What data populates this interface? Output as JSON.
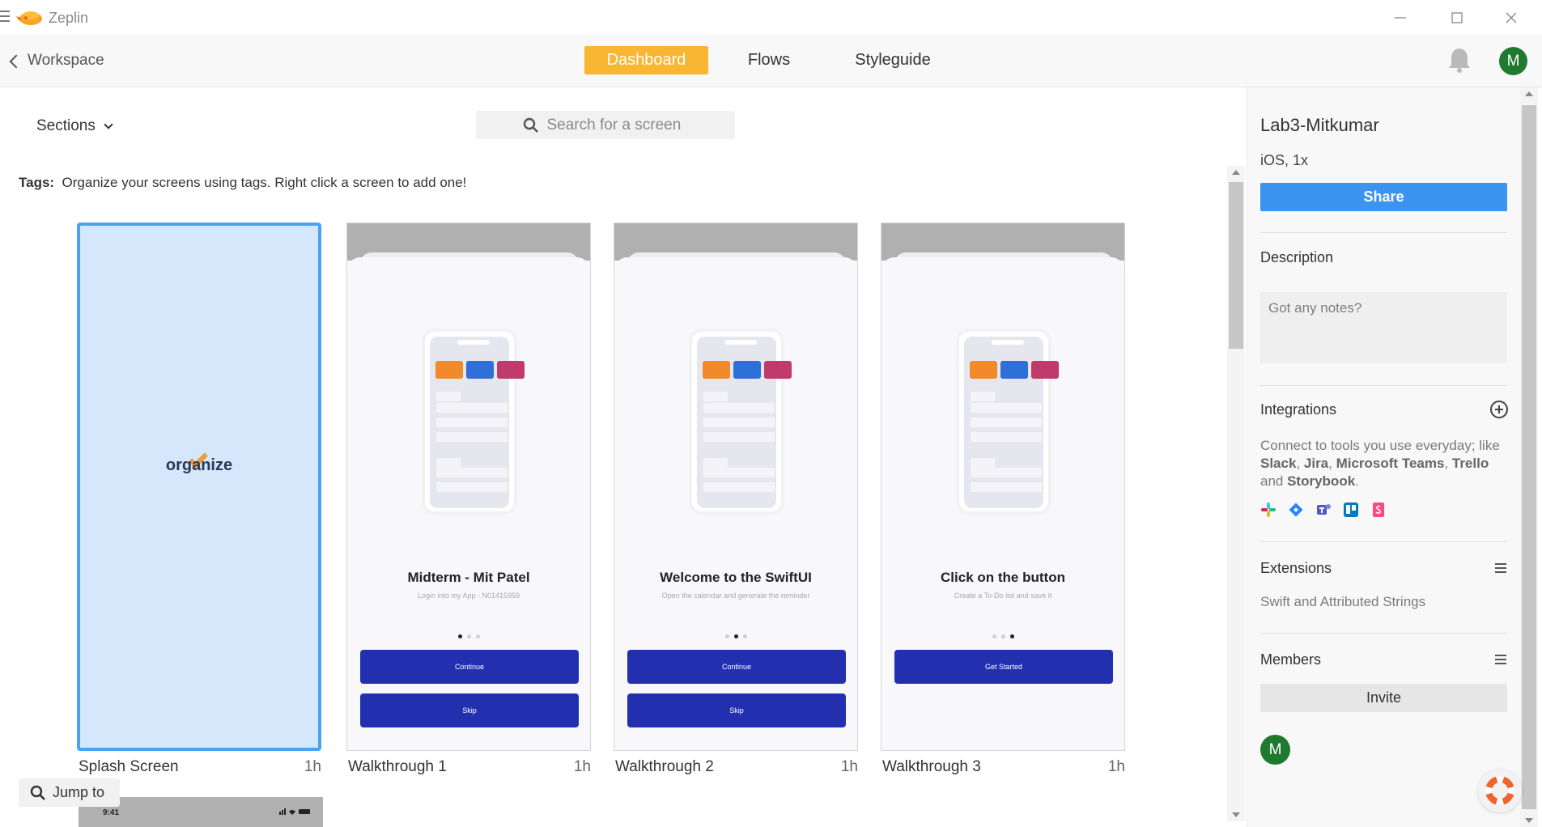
{
  "app": {
    "title": "Zeplin"
  },
  "nav": {
    "back_label": "Workspace",
    "tabs": [
      {
        "label": "Dashboard",
        "active": true
      },
      {
        "label": "Flows",
        "active": false
      },
      {
        "label": "Styleguide",
        "active": false
      }
    ],
    "user_initial": "M"
  },
  "toolbar": {
    "sections_label": "Sections",
    "search_placeholder": "Search for a screen"
  },
  "tags": {
    "label": "Tags:",
    "hint": "Organize your screens using tags. Right click a screen to add one!"
  },
  "screens": [
    {
      "name": "Splash Screen",
      "time": "1h",
      "selected": true,
      "brand_text": "organize"
    },
    {
      "name": "Walkthrough 1",
      "time": "1h",
      "title": "Midterm - Mit Patel",
      "subtitle": "Login into my App - N01415959",
      "buttons": [
        "Continue",
        "Skip"
      ],
      "active_dot": 0
    },
    {
      "name": "Walkthrough 2",
      "time": "1h",
      "title": "Welcome to the SwiftUI",
      "subtitle": "Open the calendar and generate the reminder",
      "buttons": [
        "Continue",
        "Skip"
      ],
      "active_dot": 1
    },
    {
      "name": "Walkthrough 3",
      "time": "1h",
      "title": "Click on the button",
      "subtitle": "Create a To-Do list and save it",
      "buttons": [
        "Get Started"
      ],
      "active_dot": 2
    }
  ],
  "jump_to_label": "Jump to",
  "next_row_status_time": "9:41",
  "panel": {
    "project_name": "Lab3-Mitkumar",
    "platform": "iOS, 1x",
    "share_label": "Share",
    "description_heading": "Description",
    "notes_placeholder": "Got any notes?",
    "integrations_heading": "Integrations",
    "integrations_text_1": "Connect to tools you use everyday; like ",
    "integrations_tools": [
      "Slack",
      "Jira",
      "Microsoft Teams",
      "Trello",
      "Storybook"
    ],
    "extensions_heading": "Extensions",
    "extensions_text": "Swift and Attributed Strings",
    "members_heading": "Members",
    "invite_label": "Invite",
    "member_initial": "M"
  },
  "colors": {
    "accent": "#f8b632",
    "share_blue": "#3b94f0",
    "button_navy": "#2230b0",
    "avatar_green": "#1f7a2f",
    "selected_border": "#4aa3f0"
  },
  "icons": [
    "hamburger-icon",
    "zeplin-logo",
    "chevron-left-icon",
    "bell-icon",
    "search-icon",
    "chevron-down-icon",
    "plus-circle-icon",
    "slack-icon",
    "jira-icon",
    "teams-icon",
    "trello-icon",
    "storybook-icon",
    "settings-sliders-icon",
    "help-lifebuoy-icon"
  ]
}
